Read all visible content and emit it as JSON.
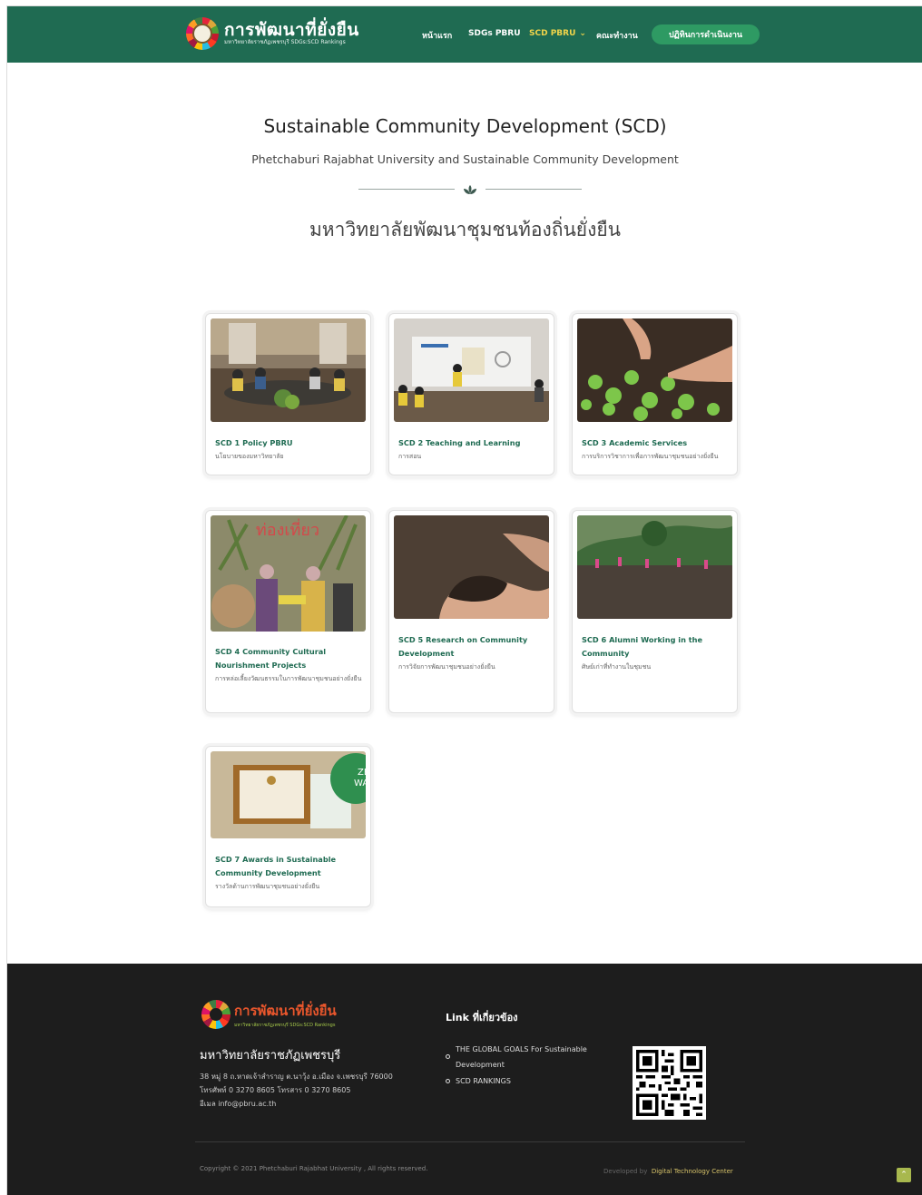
{
  "header": {
    "logo_title": "การพัฒนาที่ยั่งยืน",
    "logo_sub": "มหาวิทยาลัยราชภัฏเพชรบุรี SDGs:SCD Rankings",
    "nav": [
      {
        "label": "หน้าแรก"
      },
      {
        "label": "SDGs PBRU"
      },
      {
        "label": "SCD PBRU"
      },
      {
        "label": "คณะทำงาน"
      }
    ],
    "cta_label": "ปฏิทินการดำเนินงาน"
  },
  "hero": {
    "title": "Sustainable Community Development (SCD)",
    "subtitle": "Phetchaburi Rajabhat University  and Sustainable Community Development",
    "thai_title": "มหาวิทยาลัยพัฒนาชุมชนท้องถิ่นยั่งยืน"
  },
  "cards": [
    {
      "title": "SCD 1 Policy PBRU",
      "desc": "นโยบายของมหาวิทยาลัย"
    },
    {
      "title": "SCD 2 Teaching and Learning",
      "desc": "การสอน"
    },
    {
      "title": "SCD 3 Academic Services",
      "desc": "การบริการวิชาการเพื่อการพัฒนาชุมชนอย่างยั่งยืน"
    },
    {
      "title": "SCD 4 Community Cultural Nourishment Projects",
      "desc": "การหล่อเลี้ยงวัฒนธรรมในการพัฒนาชุมชนอย่างยั่งยืน"
    },
    {
      "title": "SCD 5 Research on Community Development",
      "desc": "การวิจัยการพัฒนาชุมชนอย่างยั่งยืน"
    },
    {
      "title": "SCD 6 Alumni Working in the Community",
      "desc": "ศิษย์เก่าที่ทำงานในชุมชน"
    },
    {
      "title": "SCD 7 Awards in Sustainable Community Development",
      "desc": "รางวัลด้านการพัฒนาชุมชนอย่างยั่งยืน"
    }
  ],
  "footer": {
    "logo_title": "การพัฒนาที่ยั่งยืน",
    "logo_sub": "มหาวิทยาลัยราชภัฏเพชรบุรี SDGs:SCD Rankings",
    "university": "มหาวิทยาลัยราชภัฏเพชรบุรี",
    "address_lines": [
      "38 หมู่ 8 ถ.หาดเจ้าสำราญ ต.นาวุ้ง อ.เมือง จ.เพชรบุรี 76000",
      "โทรศัพท์ 0 3270 8605 โทรสาร 0 3270 8605",
      "อีเมล info@pbru.ac.th"
    ],
    "links_heading": "Link ที่เกี่ยวข้อง",
    "links": [
      {
        "line1": "THE GLOBAL GOALS For Sustainable",
        "line2": "Development"
      },
      {
        "line1": "SCD RANKINGS",
        "line2": ""
      }
    ],
    "copyright": "Copyright © 2021 Phetchaburi Rajabhat University , All rights reserved.",
    "developed_by": "Developed by",
    "developer": "Digital Technology Center"
  },
  "colors": {
    "brand_green": "#1f6b52",
    "cta_green": "#2e9a63",
    "active_nav": "#f0d44a",
    "footer_bg": "#1d1d1d"
  }
}
